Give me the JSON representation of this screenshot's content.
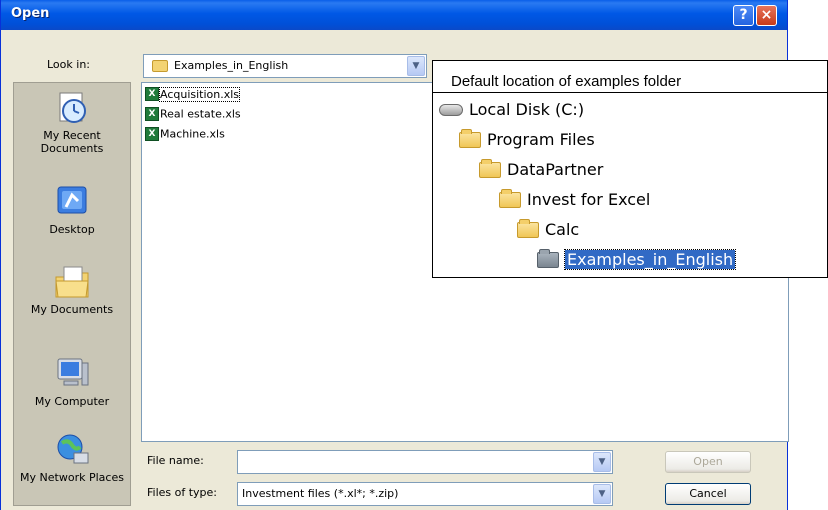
{
  "window": {
    "title": "Open",
    "help_button": "?",
    "close_button": "×"
  },
  "look_in": {
    "label": "Look in:",
    "value": "Examples_in_English",
    "folder_icon": "folder-icon"
  },
  "places": [
    {
      "label": "My Recent Documents",
      "icon": "recent-documents-icon"
    },
    {
      "label": "Desktop",
      "icon": "desktop-icon"
    },
    {
      "label": "My Documents",
      "icon": "my-documents-icon"
    },
    {
      "label": "My Computer",
      "icon": "my-computer-icon"
    },
    {
      "label": "My Network Places",
      "icon": "network-places-icon"
    }
  ],
  "files": [
    {
      "name": "Acquisition.xls",
      "icon": "excel-file-icon"
    },
    {
      "name": "Real estate.xls",
      "icon": "excel-file-icon"
    },
    {
      "name": "Machine.xls",
      "icon": "excel-file-icon"
    }
  ],
  "file_name": {
    "label": "File name:",
    "value": ""
  },
  "file_type": {
    "label": "Files of type:",
    "value": "Investment files (*.xl*; *.zip)"
  },
  "buttons": {
    "open": "Open",
    "cancel": "Cancel"
  },
  "callout": {
    "title": "Default location of examples folder",
    "tree": [
      {
        "label": "Local Disk (C:)",
        "icon": "hard-disk-icon"
      },
      {
        "label": "Program Files",
        "icon": "folder-icon"
      },
      {
        "label": "DataPartner",
        "icon": "folder-icon"
      },
      {
        "label": "Invest for Excel",
        "icon": "folder-icon"
      },
      {
        "label": "Calc",
        "icon": "folder-icon"
      },
      {
        "label": "Examples_in_English",
        "icon": "folder-icon",
        "selected": true
      }
    ]
  },
  "colors": {
    "titlebar": "#0058e6",
    "dialog_bg": "#ece9d8",
    "selection": "#316ac5"
  }
}
